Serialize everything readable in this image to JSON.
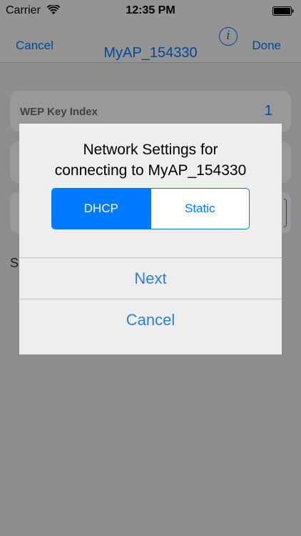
{
  "status_bar": {
    "carrier": "Carrier",
    "time": "12:35 PM"
  },
  "nav": {
    "cancel_label": "Cancel",
    "title": "MyAP_154330",
    "done_label": "Done",
    "info_icon": "info-icon"
  },
  "form": {
    "rows": [
      {
        "label": "WEP Key Index",
        "value": "1"
      }
    ],
    "partial_text": "S"
  },
  "alert": {
    "title_line1": "Network Settings for",
    "title_line2": "connecting to MyAP_154330",
    "segments": [
      "DHCP",
      "Static"
    ],
    "selected_segment": "DHCP",
    "next_label": "Next",
    "cancel_label": "Cancel"
  },
  "colors": {
    "accent": "#007aff",
    "alert_button_text": "#2e7fd6",
    "alert_background": "#eeeeee"
  }
}
